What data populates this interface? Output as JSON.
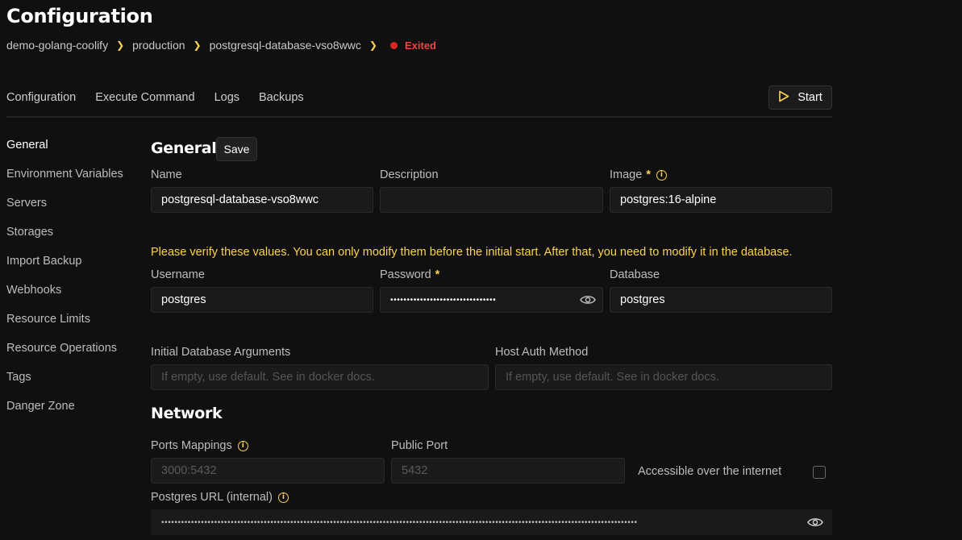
{
  "page": {
    "title": "Configuration"
  },
  "breadcrumb": {
    "items": [
      "demo-golang-coolify",
      "production",
      "postgresql-database-vso8wwc"
    ],
    "status": "Exited"
  },
  "tabs": [
    "Configuration",
    "Execute Command",
    "Logs",
    "Backups"
  ],
  "actions": {
    "start_label": "Start"
  },
  "sidebar": {
    "items": [
      "General",
      "Environment Variables",
      "Servers",
      "Storages",
      "Import Backup",
      "Webhooks",
      "Resource Limits",
      "Resource Operations",
      "Tags",
      "Danger Zone"
    ],
    "active": "General"
  },
  "general": {
    "title": "General",
    "save_label": "Save",
    "name_label": "Name",
    "name_value": "postgresql-database-vso8wwc",
    "description_label": "Description",
    "description_value": "",
    "image_label": "Image",
    "image_value": "postgres:16-alpine",
    "warning": "Please verify these values. You can only modify them before the initial start. After that, you need to modify it in the database.",
    "username_label": "Username",
    "username_value": "postgres",
    "password_label": "Password",
    "password_masked": "••••••••••••••••••••••••••••••••",
    "database_label": "Database",
    "database_value": "postgres",
    "init_args_label": "Initial Database Arguments",
    "init_args_placeholder": "If empty, use default. See in docker docs.",
    "host_auth_label": "Host Auth Method",
    "host_auth_placeholder": "If empty, use default. See in docker docs."
  },
  "network": {
    "title": "Network",
    "ports_label": "Ports Mappings",
    "ports_placeholder": "3000:5432",
    "public_port_label": "Public Port",
    "public_port_placeholder": "5432",
    "accessible_label": "Accessible over the internet",
    "accessible_checked": false,
    "url_label": "Postgres URL (internal)",
    "url_masked": "••••••••••••••••••••••••••••••••••••••••••••••••••••••••••••••••••••••••••••••••••••••••••••••••••••••••••••••••••••••••••••••••••••••••••••••••"
  },
  "colors": {
    "accent": "#fcd34d",
    "status_exited": "#ef4444",
    "background": "#101010"
  }
}
